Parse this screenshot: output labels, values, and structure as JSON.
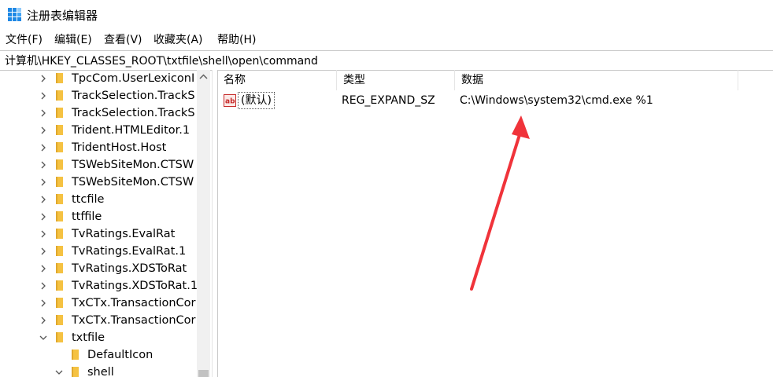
{
  "window": {
    "title": "注册表编辑器"
  },
  "menu": [
    "文件(F)",
    "编辑(E)",
    "查看(V)",
    "收藏夹(A)",
    "帮助(H)"
  ],
  "address": "计算机\\HKEY_CLASSES_ROOT\\txtfile\\shell\\open\\command",
  "tree": [
    {
      "label": "TpcCom.UserLexiconI",
      "expanded": false
    },
    {
      "label": "TrackSelection.TrackS",
      "expanded": false
    },
    {
      "label": "TrackSelection.TrackS",
      "expanded": false
    },
    {
      "label": "Trident.HTMLEditor.1",
      "expanded": false
    },
    {
      "label": "TridentHost.Host",
      "expanded": false
    },
    {
      "label": "TSWebSiteMon.CTSW",
      "expanded": false
    },
    {
      "label": "TSWebSiteMon.CTSW",
      "expanded": false
    },
    {
      "label": "ttcfile",
      "expanded": false
    },
    {
      "label": "ttffile",
      "expanded": false
    },
    {
      "label": "TvRatings.EvalRat",
      "expanded": false
    },
    {
      "label": "TvRatings.EvalRat.1",
      "expanded": false
    },
    {
      "label": "TvRatings.XDSToRat",
      "expanded": false
    },
    {
      "label": "TvRatings.XDSToRat.1",
      "expanded": false
    },
    {
      "label": "TxCTx.TransactionCor",
      "expanded": false
    },
    {
      "label": "TxCTx.TransactionCor",
      "expanded": false
    },
    {
      "label": "txtfile",
      "expanded": true
    },
    {
      "label": "DefaultIcon",
      "expanded": false
    },
    {
      "label": "shell",
      "expanded": true
    }
  ],
  "columns": {
    "name": "名称",
    "type": "类型",
    "data": "数据"
  },
  "values": [
    {
      "name": "(默认)",
      "type": "REG_EXPAND_SZ",
      "data": "C:\\Windows\\system32\\cmd.exe %1"
    }
  ],
  "colors": {
    "annotation_arrow": "#f0333a",
    "folder": "#f5c242"
  }
}
